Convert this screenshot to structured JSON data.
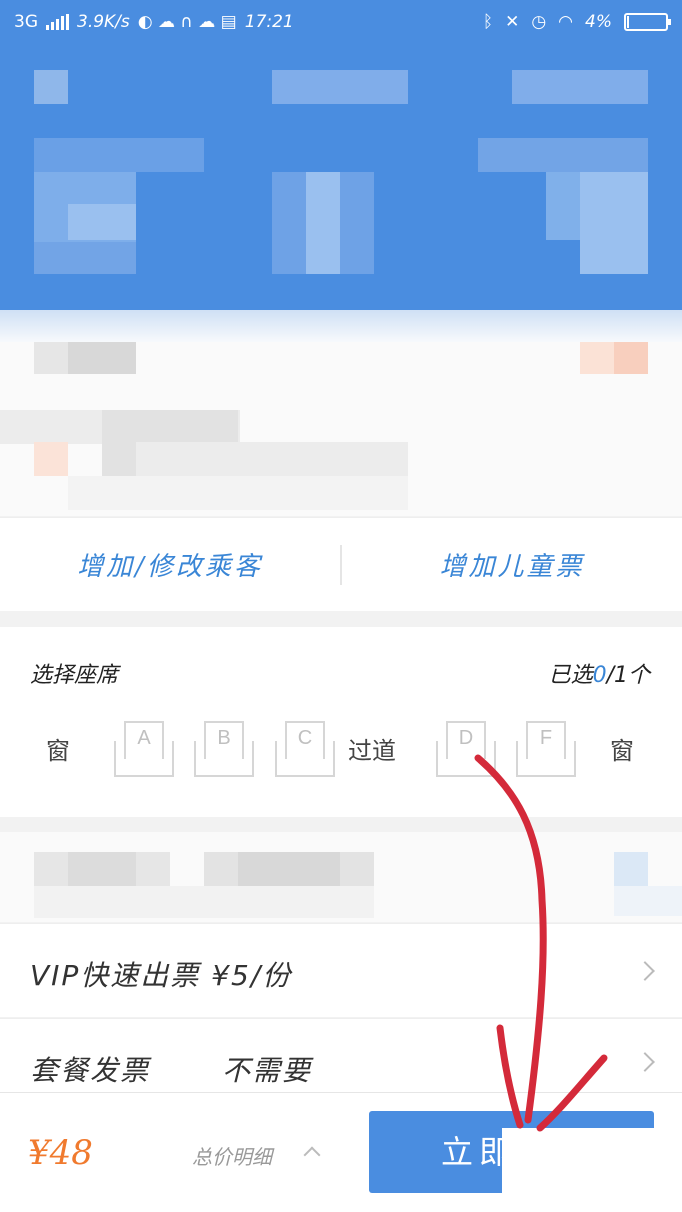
{
  "status_bar": {
    "network": "3G",
    "speed": "3.9K/s",
    "time": "17:21",
    "battery": "4%",
    "battery_level": 0.04
  },
  "passenger_actions": {
    "add_edit_label": "增加/修改乘客",
    "child_ticket_label": "增加儿童票"
  },
  "seat_selection": {
    "title": "选择座席",
    "selected_prefix": "已选",
    "selected_count": "0",
    "selected_suffix": "/1个",
    "window_label_left": "窗",
    "aisle_label": "过道",
    "window_label_right": "窗",
    "seats": [
      "A",
      "B",
      "C",
      "D",
      "F"
    ]
  },
  "options": {
    "vip_label": "VIP快速出票 ¥5/份",
    "invoice_label": "套餐发票",
    "invoice_value": "不需要"
  },
  "bottom_bar": {
    "price": "¥48",
    "price_detail_label": "总价明细",
    "submit_label": "立即"
  },
  "colors": {
    "brand_blue": "#4a8de0",
    "accent_blue": "#3a86d6",
    "price_orange": "#f07a2e",
    "annotation_red": "#d42a3a"
  },
  "icons": [
    "bluetooth-icon",
    "mute-icon",
    "alarm-icon",
    "wifi-icon",
    "battery-icon",
    "chevron-right-icon",
    "chevron-up-icon"
  ]
}
